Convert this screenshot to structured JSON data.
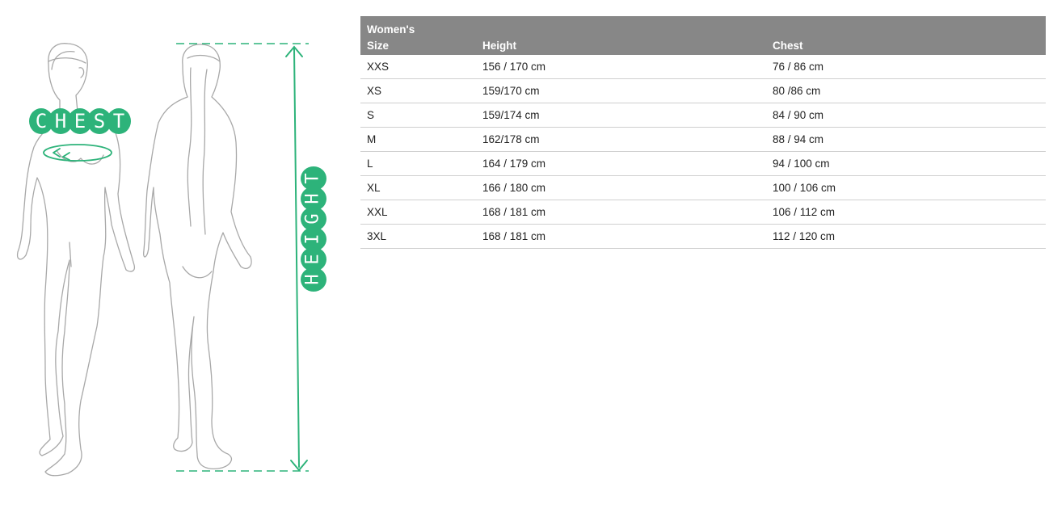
{
  "colors": {
    "accent": "#2db37a",
    "header_bg": "#878787",
    "outline": "#a8a8a8"
  },
  "illustration": {
    "chest_label": [
      "C",
      "H",
      "E",
      "S",
      "T"
    ],
    "height_label": [
      "H",
      "E",
      "I",
      "G",
      "H",
      "T"
    ]
  },
  "table": {
    "caption": "Women's",
    "headers": {
      "size": "Size",
      "height": "Height",
      "chest": "Chest"
    },
    "rows": [
      {
        "size": "XXS",
        "height": "156 / 170 cm",
        "chest": "76 / 86 cm"
      },
      {
        "size": "XS",
        "height": "159/170 cm",
        "chest": "80 /86 cm"
      },
      {
        "size": "S",
        "height": "159/174 cm",
        "chest": "84 / 90 cm"
      },
      {
        "size": "M",
        "height": "162/178 cm",
        "chest": "88 / 94 cm"
      },
      {
        "size": "L",
        "height": "164 / 179 cm",
        "chest": "94 / 100 cm"
      },
      {
        "size": "XL",
        "height": "166 / 180 cm",
        "chest": "100 / 106 cm"
      },
      {
        "size": "XXL",
        "height": "168 / 181 cm",
        "chest": "106 / 112 cm"
      },
      {
        "size": "3XL",
        "height": "168 / 181 cm",
        "chest": "112 / 120 cm"
      }
    ]
  }
}
